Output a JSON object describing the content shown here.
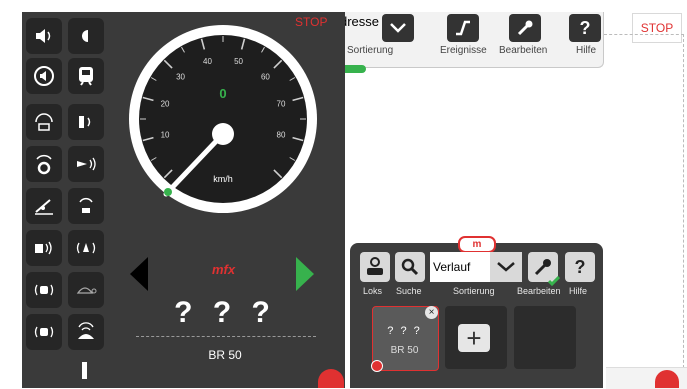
{
  "background_app": {
    "address_label": "dresse",
    "sort_label": "Sortierung",
    "events_label": "Ereignisse",
    "edit_label": "Bearbeiten",
    "help_label": "Hilfe",
    "help_glyph": "?",
    "stop_label": "STOP",
    "progress_fraction": 0.1
  },
  "control_panel": {
    "stop_label": "STOP",
    "speed_unit": "km/h",
    "speed_value": "0",
    "gauge_ticks": [
      "10",
      "20",
      "30",
      "40",
      "50",
      "60",
      "70",
      "80"
    ],
    "protocol": "mfx",
    "loco_name": "? ? ?",
    "loco_type": "BR 50",
    "function_icons": [
      "sound-icon",
      "light-icon",
      "volume-icon",
      "railcar-icon",
      "coupler-icon",
      "cab-light-icon",
      "fan-icon",
      "horn-icon",
      "shovel-icon",
      "steam-icon",
      "bell-icon",
      "chuff-icon",
      "loco-sound-icon",
      "turtle-icon",
      "brake-sound-icon",
      "pantograph-icon"
    ],
    "colors": {
      "panel": "#3a3a3a",
      "accent_green": "#37b24d",
      "stop_red": "#e03131"
    }
  },
  "loco_selector": {
    "tab_label": "m",
    "locos_label": "Loks",
    "search_label": "Suche",
    "sort_label": "Sortierung",
    "sort_value": "Verlauf",
    "edit_label": "Bearbeiten",
    "help_label": "Hilfe",
    "help_glyph": "?",
    "card": {
      "name": "? ? ?",
      "type": "BR 50"
    },
    "add_glyph": "+"
  }
}
